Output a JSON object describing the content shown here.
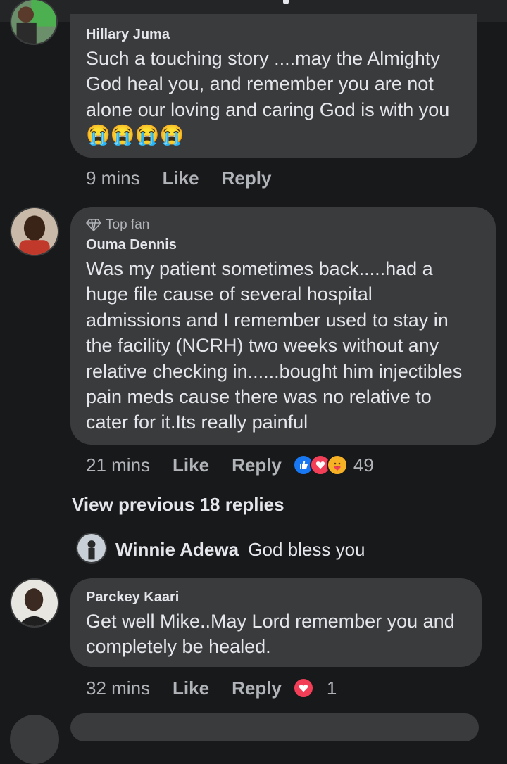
{
  "comments": [
    {
      "name": "Hillary Juma",
      "text": "Such a touching story ....may the Almighty\nGod heal you, and remember you are not\nalone our loving and caring God is with you",
      "emoji": "😭😭😭😭",
      "time": "9 mins",
      "like": "Like",
      "reply": "Reply"
    },
    {
      "badge": "Top fan",
      "name": "Ouma Dennis",
      "text": "Was my patient sometimes back.....had a\nhuge file cause of several hospital\nadmissions and I remember used to stay in\nthe facility (NCRH)  two weeks without any\nrelative checking in......bought him injectibles\npain meds cause there was no relative to\ncater for it.Its really painful",
      "time": "21 mins",
      "like": "Like",
      "reply": "Reply",
      "reaction_count": "49",
      "reactions": [
        "like-icon",
        "love-icon",
        "care-icon"
      ]
    },
    {
      "name": "Parckey Kaari",
      "text": "Get well Mike..May Lord remember you and\ncompletely be healed.",
      "time": "32 mins",
      "like": "Like",
      "reply": "Reply",
      "reaction_count": "1",
      "reactions": [
        "love-icon"
      ]
    }
  ],
  "view_previous": "View previous 18 replies",
  "inline_reply": {
    "name": "Winnie Adewa",
    "text": "God bless you"
  },
  "colors": {
    "background": "#18191a",
    "bubble": "#3a3b3c",
    "like_blue": "#1877f2",
    "love_red": "#f33e58",
    "care_yellow": "#f7b125"
  }
}
